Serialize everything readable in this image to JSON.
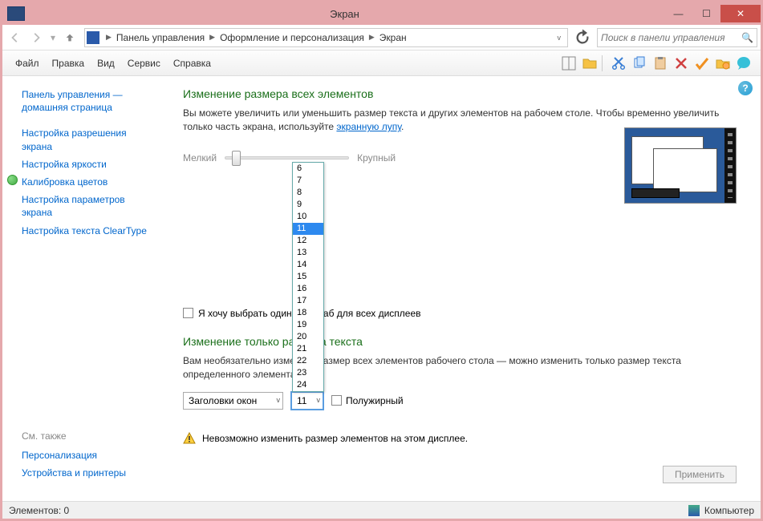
{
  "window": {
    "title": "Экран"
  },
  "breadcrumb": {
    "items": [
      "Панель управления",
      "Оформление и персонализация",
      "Экран"
    ]
  },
  "search": {
    "placeholder": "Поиск в панели управления"
  },
  "menu": {
    "file": "Файл",
    "edit": "Правка",
    "view": "Вид",
    "tools": "Сервис",
    "help": "Справка"
  },
  "sidebar": {
    "items": [
      "Панель управления — домашняя страница",
      "Настройка разрешения экрана",
      "Настройка яркости",
      "Калибровка цветов",
      "Настройка параметров экрана",
      "Настройка текста ClearType"
    ],
    "see_also_label": "См. также",
    "see_also": [
      "Персонализация",
      "Устройства и принтеры"
    ]
  },
  "main": {
    "heading1": "Изменение размера всех элементов",
    "body1_pre": "Вы можете увеличить или уменьшить размер текста и других элементов на рабочем столе. Чтобы временно увеличить только часть экрана, используйте ",
    "body1_link": "экранную лупу",
    "body1_post": ".",
    "slider_small": "Мелкий",
    "slider_big": "Крупный",
    "checkbox_label": "Я хочу выбрать один масштаб для всех дисплеев",
    "heading2": "Изменение только размера текста",
    "body2": "Вам необязательно изменять размер всех элементов рабочего стола — можно изменить только размер текста определенного элемента.",
    "element_select": "Заголовки окон",
    "size_select": "11",
    "bold_label": "Полужирный",
    "size_options": [
      "6",
      "7",
      "8",
      "9",
      "10",
      "11",
      "12",
      "13",
      "14",
      "15",
      "16",
      "17",
      "18",
      "19",
      "20",
      "21",
      "22",
      "23",
      "24"
    ],
    "warning": "Невозможно изменить размер элементов на этом дисплее.",
    "apply": "Применить"
  },
  "statusbar": {
    "left": "Элементов: 0",
    "right": "Компьютер"
  }
}
